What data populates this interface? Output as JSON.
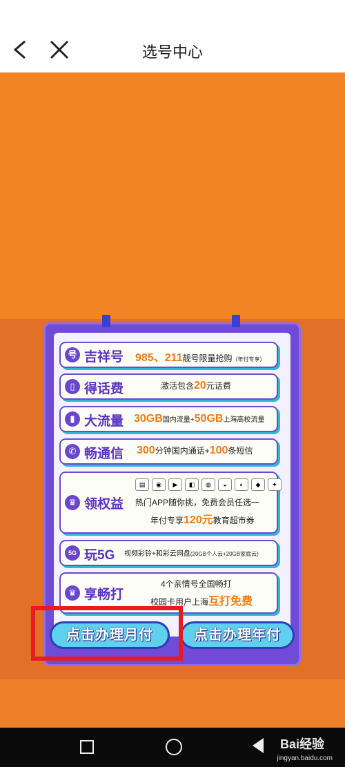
{
  "header": {
    "title": "选号中心"
  },
  "rows": [
    {
      "icon_char": "号",
      "name": "吉祥号",
      "hl1": "985、211",
      "text1": "靓号限量抢购",
      "small1": "（年付专享）"
    },
    {
      "icon_char": "",
      "name": "得话费",
      "text1": "激活包含",
      "hl1": "20",
      "text2": "元话费"
    },
    {
      "icon_char": "",
      "name": "大流量",
      "hl1": "30GB",
      "text1": "国内流量+",
      "hl2": "50GB",
      "text2": "上海高校流量"
    },
    {
      "icon_char": "",
      "name": "畅通信",
      "hl1": "300",
      "text1": "分钟国内通话+",
      "hl2": "100",
      "text2": "条短信"
    },
    {
      "icon_char": "",
      "name": "领权益",
      "line1": "热门APP随你挑，免费会员任选一",
      "line2a": "年付专享",
      "hl1": "120元",
      "line2b": "教育超市券"
    },
    {
      "icon_char": "",
      "name": "玩5G",
      "text1": "视频彩铃+和彩云网盘",
      "small1": "(20GB个人云+20GB家庭云)"
    },
    {
      "icon_char": "",
      "name": "享畅打",
      "line1": "4个亲情号全国畅打",
      "line2a": "校园卡用户上海",
      "hl1": "互打免费"
    }
  ],
  "buttons": {
    "monthly": "点击办理月付",
    "yearly": "点击办理年付"
  },
  "watermark": {
    "brand": "Bai经验",
    "url": "jingyan.baidu.com"
  },
  "colors": {
    "accent_orange": "#f28426",
    "card_purple": "#6f4bd8",
    "highlight": "#f47a12",
    "annotation_red": "#e81c1c"
  }
}
